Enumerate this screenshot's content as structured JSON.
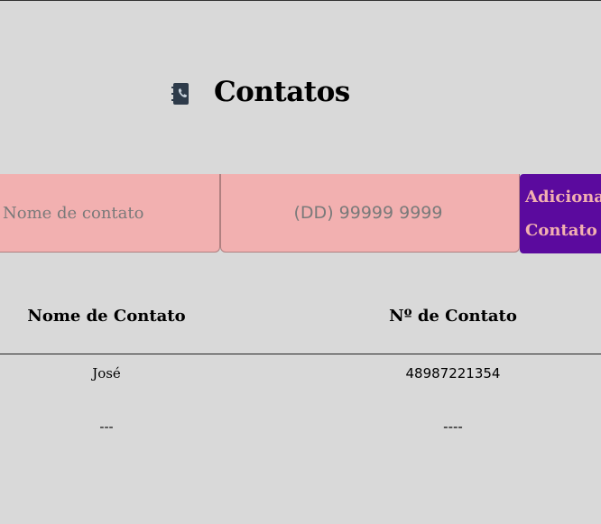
{
  "header": {
    "title": "Contatos",
    "icon": "address-book-icon"
  },
  "form": {
    "name_placeholder": "Nome de contato",
    "phone_placeholder": "(DD) 99999 9999",
    "add_button_label": "Adicionar\nContato"
  },
  "table": {
    "columns": [
      "Nome de Contato",
      "Nº de Contato"
    ],
    "rows": [
      {
        "name": "José",
        "phone": "48987221354"
      },
      {
        "name": "---",
        "phone": "----"
      }
    ]
  },
  "colors": {
    "background": "#d9d9d9",
    "input_fill": "#f2b0b0",
    "button_fill": "#5b0a9e",
    "button_text": "#f2b0b0"
  }
}
